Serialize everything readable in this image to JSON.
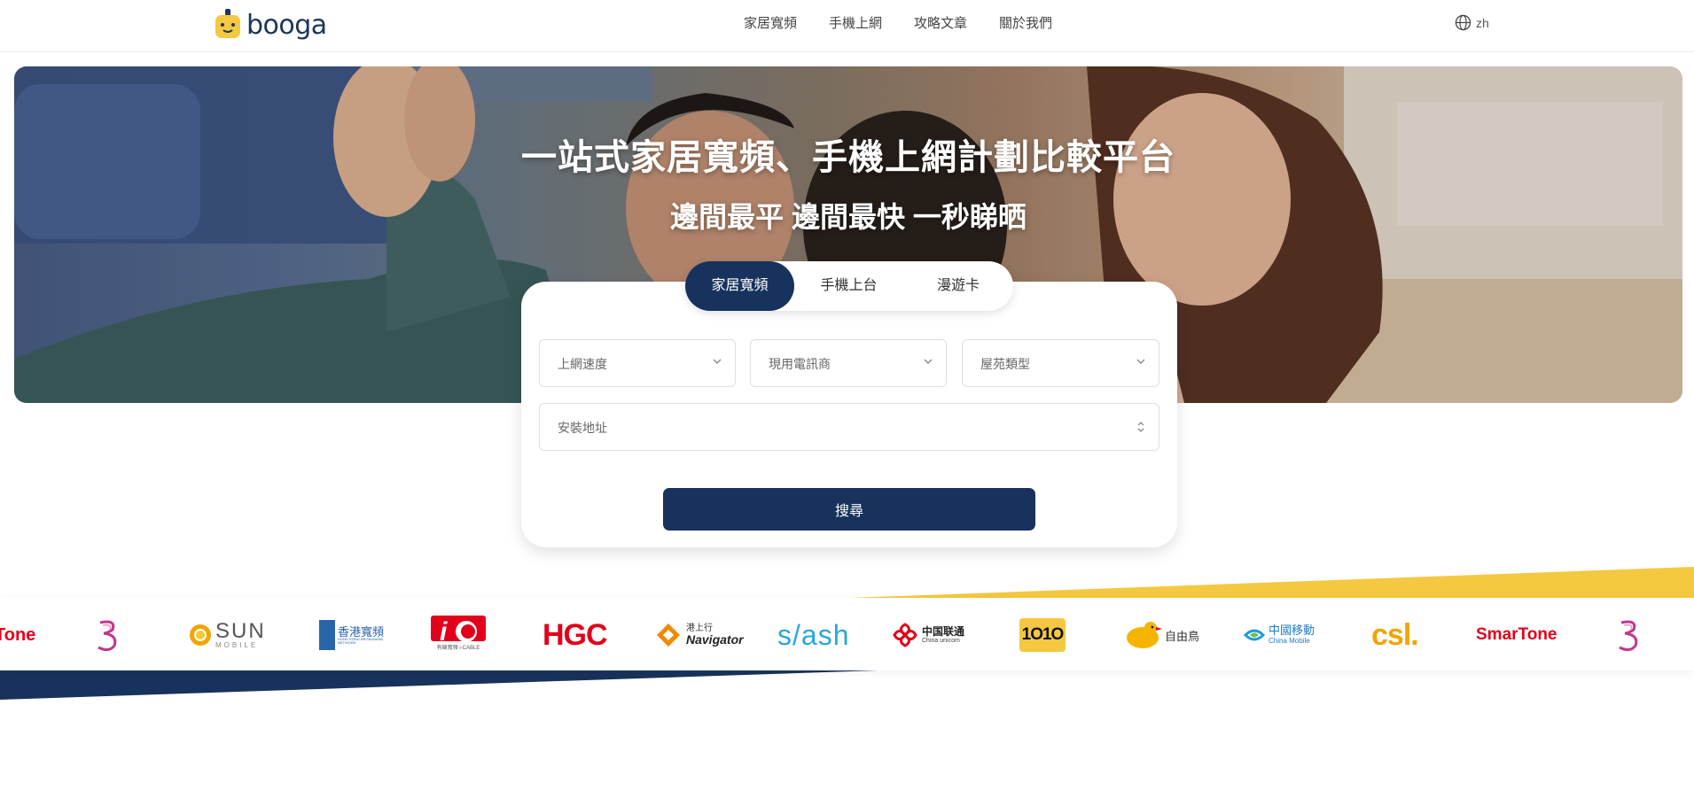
{
  "header": {
    "logo_text": "booga",
    "nav": [
      "家居寬頻",
      "手機上網",
      "攻略文章",
      "關於我們"
    ],
    "lang": "zh",
    "lang_icon": "globe-icon"
  },
  "hero": {
    "title": "一站式家居寬頻、手機上網計劃比較平台",
    "subtitle": "邊間最平 邊間最快 一秒睇晒"
  },
  "search": {
    "tabs": [
      "家居寬頻",
      "手機上台",
      "漫遊卡"
    ],
    "active_tab": "家居寬頻",
    "speed_placeholder": "上網速度",
    "provider_placeholder": "現用電訊商",
    "estate_placeholder": "屋苑類型",
    "address_placeholder": "安裝地址",
    "button": "搜尋"
  },
  "providers": {
    "logos": [
      "SmarTone",
      "3",
      "SUN MOBILE",
      "香港寬頻",
      "i-CABLE",
      "HGC",
      "Navigator",
      "s/ash",
      "China Unicom",
      "1O1O",
      "自由鳥",
      "中國移動",
      "csl.",
      "SmarTone",
      "3"
    ],
    "sun_text": "SUN",
    "sun_sub": "MOBILE",
    "hkbn_cn": "香港寬頻",
    "hkbn_en": "HONG KONG BROADBAND NETWORK",
    "icable_sub": "有線寬頻 i-CABLE",
    "hgc": "HGC",
    "navigator_cn": "港上行",
    "navigator_en": "Navigator",
    "slash": "s/ash",
    "unicom_cn": "中国联通",
    "unicom_en": "China unicom",
    "tenten": "1O1O",
    "birdie": "自由鳥",
    "cmhk_cn": "中國移動",
    "cmhk_en": "China Mobile",
    "csl": "csl.",
    "smartone": "SmarTone",
    "smartone_cut": "Tone"
  },
  "colors": {
    "navy": "#17325c",
    "yellow": "#f5c842",
    "hkt_red": "#e2001a"
  }
}
